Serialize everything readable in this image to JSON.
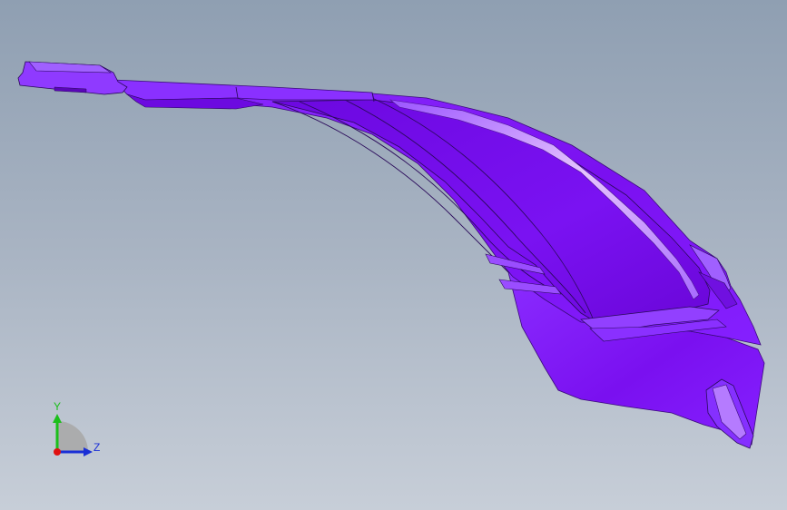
{
  "viewport": {
    "background_top": "#8f9fb2",
    "background_bottom": "#c7ced8"
  },
  "model": {
    "part_color": "#7a10f0",
    "shade_color": "#6a0ad6",
    "highlight_color": "#d7a8ff",
    "edge_color": "#2a0a5a"
  },
  "triad": {
    "y_label": "Y",
    "z_label": "Z",
    "y_color": "#1bbf1b",
    "z_color": "#1a2fd6",
    "origin_color": "#e01010"
  }
}
